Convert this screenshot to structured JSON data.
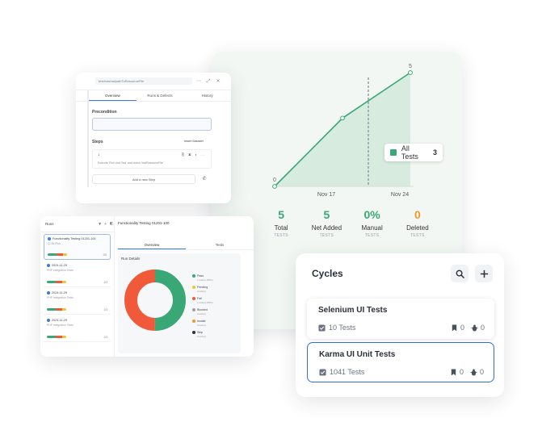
{
  "chart": {
    "start_value": "0",
    "end_value": "5",
    "x_ticks": [
      "Nov 17",
      "Nov 24"
    ],
    "legend_label": "All Tests",
    "legend_count": "3",
    "accent": "#3aa776"
  },
  "chart_data": {
    "type": "area",
    "series": [
      {
        "name": "All Tests",
        "x": [
          0,
          1,
          2
        ],
        "values": [
          0,
          3,
          5
        ]
      }
    ],
    "x_tick_labels": [
      "Nov 17",
      "Nov 24"
    ],
    "point_labels": [
      "0",
      "5"
    ]
  },
  "stats": [
    {
      "value": "5",
      "label": "Total",
      "sub": "TESTS",
      "color": "#3aa776"
    },
    {
      "value": "5",
      "label": "Net Added",
      "sub": "TESTS",
      "color": "#3aa776"
    },
    {
      "value": "0%",
      "label": "Manual",
      "sub": "TESTS",
      "color": "#3aa776"
    },
    {
      "value": "0",
      "label": "Deleted",
      "sub": "TESTS",
      "color": "#f2992e"
    }
  ],
  "editor": {
    "path": "test/tutorial/pathToResourceFile",
    "tabs": [
      "Overview",
      "Runs & Defects",
      "History"
    ],
    "precondition_label": "Precondition",
    "steps_label": "Steps",
    "insert_dataset": "Insert Dataset",
    "step_number": "1",
    "step_text": "Execute 'Run Unit Test' and check 'testResourceFile'",
    "add_step": "Add a new Step"
  },
  "runs": {
    "header": "Runs",
    "title": "Functionality Testing 01201-100",
    "tabs": [
      "Overview",
      "Tests"
    ],
    "details_label": "Run Details",
    "items": [
      {
        "title": "Functionality Testing 01201-100",
        "sub": "Q: Mr.Plus",
        "meta": "2/5",
        "selected": true
      },
      {
        "title": "2024-11-29",
        "sub": "PHP Integration Tests",
        "meta": "2/3",
        "selected": false
      },
      {
        "title": "2024-11-29",
        "sub": "PHP Integration Tests",
        "meta": "2/3",
        "selected": false
      },
      {
        "title": "2024-11-29",
        "sub": "PHP Integration Tests",
        "meta": "2/3",
        "selected": false
      },
      {
        "title": "2024-11-29",
        "sub": "PHP Integration Tests",
        "meta": "",
        "selected": false
      }
    ],
    "legend": [
      {
        "label": "Pass",
        "sub": "1 test(s) (50%)",
        "color": "#3aa776"
      },
      {
        "label": "Pending",
        "sub": "0 test(s)",
        "color": "#f2c23a"
      },
      {
        "label": "Fail",
        "sub": "1 test(s) (50%)",
        "color": "#f05a3a"
      },
      {
        "label": "Blocked",
        "sub": "0 test(s)",
        "color": "#9aa0a8"
      },
      {
        "label": "Invalid",
        "sub": "0 test(s)",
        "color": "#f2992e"
      },
      {
        "label": "Skip",
        "sub": "0 test(s)",
        "color": "#2a2f3a"
      }
    ],
    "donut": {
      "pass": 0.5,
      "fail": 0.5
    }
  },
  "cycles": {
    "title": "Cycles",
    "items": [
      {
        "name": "Selenium UI Tests",
        "tests": "10 Tests",
        "bookmarks": "0",
        "bugs": "0",
        "selected": false
      },
      {
        "name": "Karma UI Unit Tests",
        "tests": "1041 Tests",
        "bookmarks": "0",
        "bugs": "0",
        "selected": true
      }
    ]
  }
}
